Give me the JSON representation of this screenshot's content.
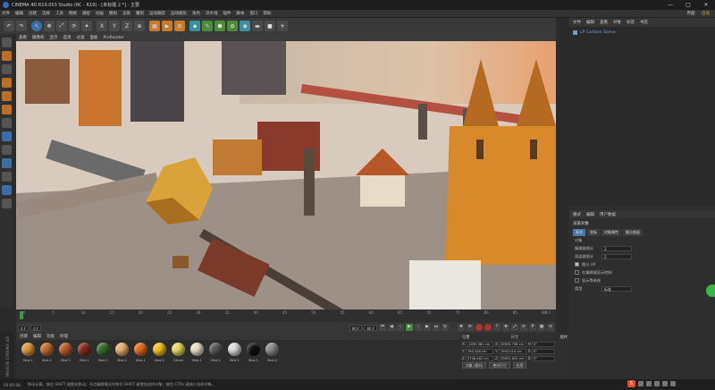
{
  "window": {
    "title": "CINEMA 4D R19.053 Studio (RC - R19) - [未标题 2 *] - 主要",
    "controls": [
      "—",
      "□",
      "✕"
    ]
  },
  "menubar": {
    "items": [
      "文件",
      "编辑",
      "创建",
      "选择",
      "工具",
      "网格",
      "捕捉",
      "动画",
      "模拟",
      "渲染",
      "雕刻",
      "运动跟踪",
      "运动图形",
      "角色",
      "流水线",
      "插件",
      "脚本",
      "窗口",
      "帮助"
    ],
    "right_label": "界面:",
    "right_value": "启动"
  },
  "toolbar": {
    "icons": [
      "undo-icon",
      "redo-icon",
      "select-icon",
      "move-icon",
      "scale-icon",
      "rotate-icon",
      "last-tool-icon",
      "x-axis-icon",
      "y-axis-icon",
      "z-axis-icon",
      "coord-system-icon",
      "clapper-icon",
      "render-view-icon",
      "render-settings-icon",
      "cube-icon",
      "pen-icon",
      "subdivision-icon",
      "array-icon",
      "deformer-icon",
      "floor-icon",
      "camera-icon",
      "light-icon"
    ],
    "axis_labels": [
      "X",
      "Y",
      "Z"
    ]
  },
  "viewport": {
    "menu": [
      "查看",
      "摄像机",
      "显示",
      "选项",
      "过滤",
      "面板",
      "ProRender"
    ]
  },
  "timeline": {
    "ticks": [
      "0",
      "5",
      "10",
      "15",
      "20",
      "25",
      "30",
      "35",
      "40",
      "45",
      "50",
      "55",
      "60",
      "65",
      "70",
      "75",
      "80",
      "85",
      "90"
    ],
    "end_frame": "0 F"
  },
  "playback": {
    "start_field": "0 F",
    "min_field": "0 F",
    "max_field": "90 F",
    "end_field": "90 F"
  },
  "materials": {
    "menu": [
      "创建",
      "编辑",
      "功能",
      "纹理"
    ],
    "items": [
      {
        "label": "Mat.1",
        "color": "#d89a3a"
      },
      {
        "label": "Mat.1",
        "color": "#c26a2a"
      },
      {
        "label": "Mat.1",
        "color": "#b85a2a"
      },
      {
        "label": "Mat.1",
        "color": "#8a2a1a"
      },
      {
        "label": "Mat.1",
        "color": "#3a6a2a"
      },
      {
        "label": "Mat.1",
        "color": "#e8b070"
      },
      {
        "label": "Mat.1",
        "color": "#e06a1a"
      },
      {
        "label": "Mat.1",
        "color": "#f0c020"
      },
      {
        "label": "Ghost",
        "color": "#e8d860"
      },
      {
        "label": "Mat.1",
        "color": "#e8e0c8"
      },
      {
        "label": "Mat.1",
        "color": "#555555"
      },
      {
        "label": "Mat.1",
        "color": "#dddddd"
      },
      {
        "label": "Mat.1",
        "color": "#111111"
      },
      {
        "label": "Mat.4",
        "color": "#888888"
      }
    ]
  },
  "logo": "MAXON CINEMA 4D",
  "coords": {
    "headers": [
      "位置",
      "尺寸",
      "旋转"
    ],
    "rows": [
      {
        "axis": "X",
        "pos": "-1050.581 cm",
        "size": "29634.758 cm",
        "rot_label": "H",
        "rot": "0°"
      },
      {
        "axis": "Y",
        "pos": "765.546 cm",
        "size": "1903.014 cm",
        "rot_label": "P",
        "rot": "0°"
      },
      {
        "axis": "Z",
        "pos": "5746.462 cm",
        "size": "29631.815 cm",
        "rot_label": "B",
        "rot": "0°"
      }
    ],
    "mode_button": "对象 (相对)",
    "size_button": "绝对尺寸",
    "apply_button": "应用"
  },
  "objects": {
    "tabs": [
      "文件",
      "编辑",
      "查看",
      "对象",
      "标签",
      "书签"
    ],
    "items": [
      {
        "name": "LP Cartoon Scene"
      }
    ]
  },
  "attributes": {
    "menu": [
      "模式",
      "编辑",
      "用户数据"
    ],
    "title": "渲染对象",
    "tabs": [
      {
        "label": "基本",
        "active": true
      },
      {
        "label": "坐标",
        "active": false
      },
      {
        "label": "对象属性",
        "active": false
      },
      {
        "label": "细分曲面",
        "active": false
      }
    ],
    "section": "对象",
    "rows": [
      {
        "label": "编辑器细分",
        "value": "2"
      },
      {
        "label": "渲染器细分",
        "value": "2"
      }
    ],
    "checkbox_rows": [
      {
        "label": "细分 UV",
        "checked": true
      },
      {
        "label": "在编辑器显示控制",
        "checked": false
      },
      {
        "label": "显示等参线",
        "checked": false
      }
    ],
    "mode_label": "类型",
    "mode_value": "标准"
  },
  "statusbar": {
    "time": "00:00:08",
    "text": "移动元素。按住 SHIFT 键量化移动；节点编辑模式时按住 SHIFT 键增加选择对象；按住 CTRL 键减少选择对象。"
  }
}
